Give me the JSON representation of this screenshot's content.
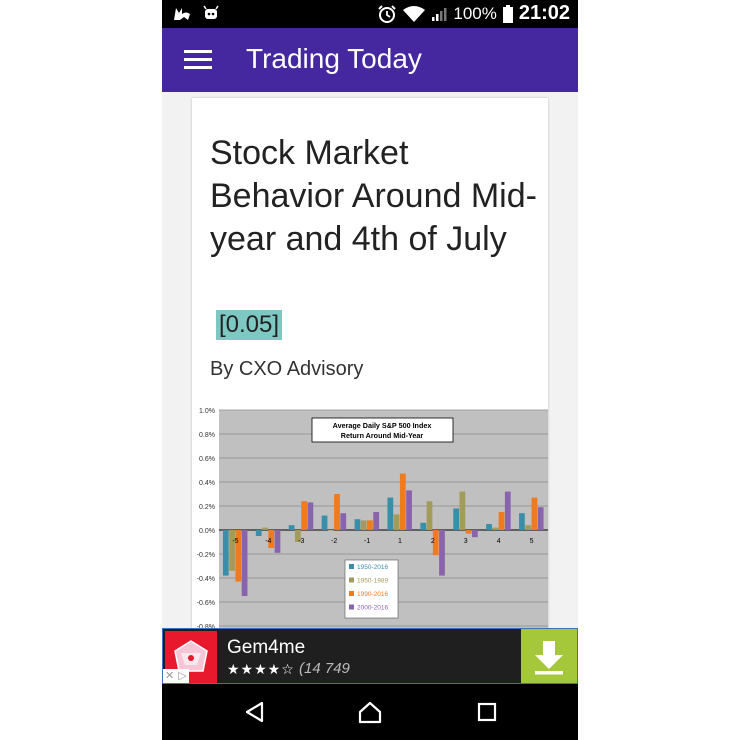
{
  "status": {
    "battery": "100%",
    "time": "21:02"
  },
  "app": {
    "title": "Trading Today"
  },
  "article": {
    "headline": "Stock Market Behavior Around Mid-year and 4th of July",
    "score": "[0.05]",
    "byline": "By CXO Advisory"
  },
  "chart_data": {
    "type": "bar",
    "title": "Average Daily S&P 500 Index Return Around Mid-Year",
    "categories": [
      "-5",
      "-4",
      "-3",
      "-2",
      "-1",
      "1",
      "2",
      "3",
      "4",
      "5"
    ],
    "series": [
      {
        "name": "1950-2016",
        "color": "#3a8fa8",
        "values": [
          -0.38,
          -0.05,
          0.04,
          0.12,
          0.09,
          0.27,
          0.06,
          0.18,
          0.05,
          0.14
        ]
      },
      {
        "name": "1950-1989",
        "color": "#a39b5a",
        "values": [
          -0.34,
          0.02,
          -0.1,
          0.0,
          0.08,
          0.13,
          0.24,
          0.32,
          0.02,
          0.04
        ]
      },
      {
        "name": "1990-2016",
        "color": "#f07a1e",
        "values": [
          -0.43,
          -0.15,
          0.24,
          0.3,
          0.08,
          0.47,
          -0.21,
          -0.03,
          0.15,
          0.27
        ]
      },
      {
        "name": "2000-2016",
        "color": "#8a63ad",
        "values": [
          -0.55,
          -0.19,
          0.23,
          0.14,
          0.15,
          0.33,
          -0.38,
          -0.06,
          0.32,
          0.19
        ]
      }
    ],
    "yticks": [
      "1.0%",
      "0.8%",
      "0.6%",
      "0.4%",
      "0.2%",
      "0.0%",
      "-0.2%",
      "-0.4%",
      "-0.6%",
      "-0.8%"
    ],
    "ylim": [
      -0.9,
      1.0
    ],
    "grid": true,
    "legend": "bottom-center"
  },
  "ad": {
    "app_name": "Gem4me",
    "stars": "★★★★☆",
    "reviews": "(14 749"
  },
  "colors": {
    "app_bar": "#4527a0",
    "download": "#a5c83a"
  }
}
